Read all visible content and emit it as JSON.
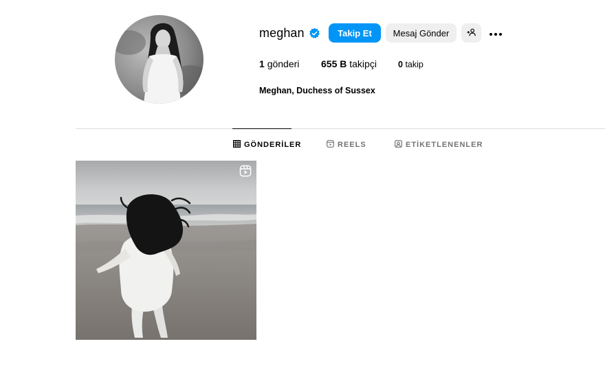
{
  "profile": {
    "username": "meghan",
    "verified": true,
    "full_name": "Meghan, Duchess of Sussex",
    "buttons": {
      "follow": "Takip Et",
      "message": "Mesaj Gönder"
    },
    "stats": {
      "posts_value": "1",
      "posts_label": "gönderi",
      "followers_value": "655 B",
      "followers_label": "takipçi",
      "following_value": "0",
      "following_label": "takip"
    }
  },
  "tabs": [
    {
      "label": "GÖNDERİLER",
      "icon": "grid-icon",
      "active": true
    },
    {
      "label": "REELS",
      "icon": "reels-icon",
      "active": false
    },
    {
      "label": "ETİKETLENENLER",
      "icon": "tagged-icon",
      "active": false
    }
  ],
  "posts": [
    {
      "type": "reel",
      "icon": "reel-badge-icon"
    }
  ],
  "colors": {
    "accent": "#0095f6",
    "button_gray": "#efefef",
    "muted_text": "#737373",
    "divider": "#dbdbdb"
  }
}
